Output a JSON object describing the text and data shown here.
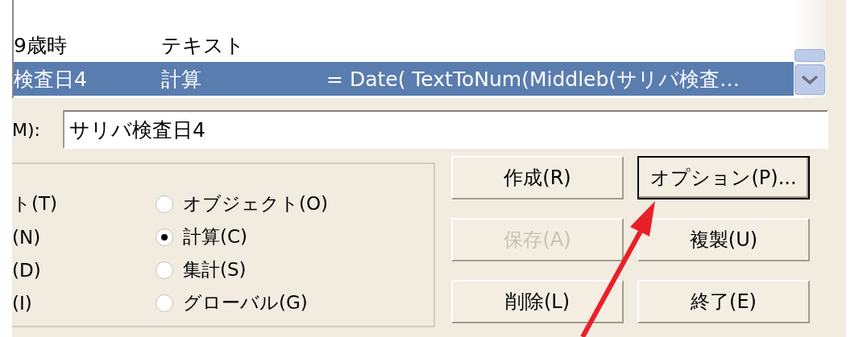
{
  "field_list": {
    "rows": [
      {
        "name": "9歳時",
        "type": "テキスト",
        "formula": "",
        "selected": false
      },
      {
        "name": "検査日4",
        "type": "計算",
        "formula": "= Date( TextToNum(Middleb(サリバ検査…",
        "selected": true
      }
    ]
  },
  "field_name": {
    "label": "M):",
    "value": "サリバ検査日4"
  },
  "type_group": {
    "cut_labels": [
      "ト(T)",
      "(N)",
      "(D)",
      "(I)"
    ],
    "options": [
      {
        "label": "オブジェクト(O)",
        "selected": false
      },
      {
        "label": "計算(C)",
        "selected": true
      },
      {
        "label": "集計(S)",
        "selected": false
      },
      {
        "label": "グローバル(G)",
        "selected": false
      }
    ]
  },
  "buttons": [
    {
      "label": "作成(R)",
      "disabled": false,
      "default": false
    },
    {
      "label": "オプション(P)...",
      "disabled": false,
      "default": true
    },
    {
      "label": "保存(A)",
      "disabled": true,
      "default": false
    },
    {
      "label": "複製(U)",
      "disabled": false,
      "default": false
    },
    {
      "label": "削除(L)",
      "disabled": false,
      "default": false
    },
    {
      "label": "終了(E)",
      "disabled": false,
      "default": false
    }
  ]
}
